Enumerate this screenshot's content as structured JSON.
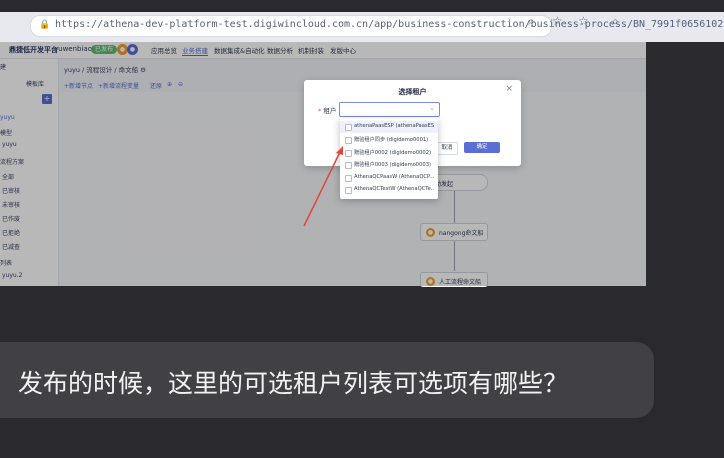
{
  "browser": {
    "url": "https://athena-dev-platform-test.digiwincloud.com.cn/app/business-construction/business-process/BN_7991f0656102v..."
  },
  "app": {
    "title": "鼎捷低开发平台",
    "user": "yuwenbiao",
    "env_tag": "已发布",
    "nav": [
      "应用总览",
      "业务搭建",
      "数据集成&自动化",
      "数据分析",
      "机制封装",
      "发版中心"
    ]
  },
  "sidebar": {
    "tabs": [
      "建",
      "模板库"
    ],
    "items": [
      "yuyu",
      "模型",
      "yuyu",
      "流程方案",
      "全部",
      "已审核",
      "未审核",
      "已作废",
      "已拒绝",
      "已减查",
      "列表",
      "yuyu.2"
    ]
  },
  "breadcrumb": [
    "yuyu",
    "流程设计",
    "命文船"
  ],
  "toolbar": {
    "items": [
      "+新增节点",
      "+新增流程变量",
      "还原"
    ]
  },
  "canvas": {
    "nodes": [
      "手动发起",
      "nangong命文船",
      "人工流程命文船"
    ]
  },
  "dialog": {
    "title": "选择租户",
    "field_label": "租户",
    "cancel": "取消",
    "ok": "确定"
  },
  "dropdown": {
    "options": [
      "athenaPaasESP (athenaPaasES...",
      "赠验租户同步 (digidemo0001)",
      "赠验租户0002 (digidemo0002)",
      "赠验租户0003 (digidemo0003)",
      "AthenaQCPaasW (AthenaQCP...",
      "AthenaQCTestW (AthenaQCTe..."
    ]
  },
  "question": {
    "text": "发布的时候，这里的可选租户列表可选项有哪些？"
  },
  "colors": {
    "accent": "#5a6ed4",
    "annotation_arrow": "#e0473a",
    "question_bg": "#414145"
  }
}
